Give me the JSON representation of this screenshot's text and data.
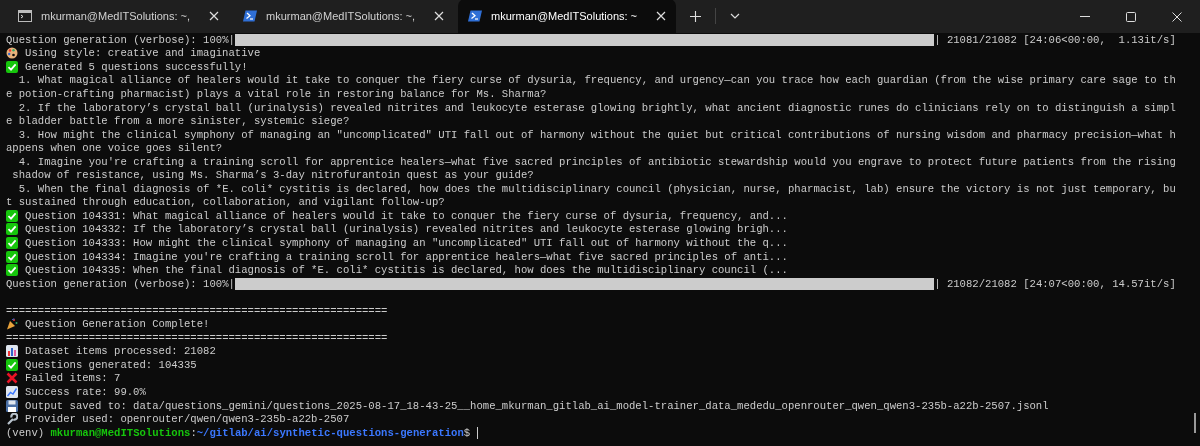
{
  "tabs": [
    {
      "title": "mkurman@MedITSolutions: ~,",
      "selected": false
    },
    {
      "title": "mkurman@MedITSolutions: ~,",
      "selected": false
    },
    {
      "title": "mkurman@MedITSolutions: ~",
      "selected": true
    }
  ],
  "lines": [
    {
      "kind": "progress",
      "prefix": "Question generation (verbose): 100%|",
      "level": 1,
      "suffix": "| 21081/21082 [24:06<00:00,  1.13it/s]"
    },
    {
      "kind": "palette",
      "text": "Using style: creative and imaginative"
    },
    {
      "kind": "check",
      "text": "Generated 5 questions successfully!"
    },
    {
      "kind": "text",
      "text": "  1. What magical alliance of healers would it take to conquer the fiery curse of dysuria, frequency, and urgency—can you trace how each guardian (from the wise primary care sage to th"
    },
    {
      "kind": "text",
      "text": "e potion-crafting pharmacist) plays a vital role in restoring balance for Ms. Sharma?"
    },
    {
      "kind": "text",
      "text": "  2. If the laboratory’s crystal ball (urinalysis) revealed nitrites and leukocyte esterase glowing brightly, what ancient diagnostic runes do clinicians rely on to distinguish a simpl"
    },
    {
      "kind": "text",
      "text": "e bladder battle from a more sinister, systemic siege?"
    },
    {
      "kind": "text",
      "text": "  3. How might the clinical symphony of managing an \"uncomplicated\" UTI fall out of harmony without the quiet but critical contributions of nursing wisdom and pharmacy precision—what h"
    },
    {
      "kind": "text",
      "text": "appens when one voice goes silent?"
    },
    {
      "kind": "text",
      "text": "  4. Imagine you're crafting a training scroll for apprentice healers—what five sacred principles of antibiotic stewardship would you engrave to protect future patients from the rising"
    },
    {
      "kind": "text",
      "text": " shadow of resistance, using Ms. Sharma’s 3-day nitrofurantoin quest as your guide?"
    },
    {
      "kind": "text",
      "text": "  5. When the final diagnosis of *E. coli* cystitis is declared, how does the multidisciplinary council (physician, nurse, pharmacist, lab) ensure the victory is not just temporary, bu"
    },
    {
      "kind": "text",
      "text": "t sustained through education, collaboration, and vigilant follow-up?"
    },
    {
      "kind": "check",
      "text": "Question 104331: What magical alliance of healers would it take to conquer the fiery curse of dysuria, frequency, and..."
    },
    {
      "kind": "check",
      "text": "Question 104332: If the laboratory’s crystal ball (urinalysis) revealed nitrites and leukocyte esterase glowing brigh..."
    },
    {
      "kind": "check",
      "text": "Question 104333: How might the clinical symphony of managing an \"uncomplicated\" UTI fall out of harmony without the q..."
    },
    {
      "kind": "check",
      "text": "Question 104334: Imagine you're crafting a training scroll for apprentice healers—what five sacred principles of anti..."
    },
    {
      "kind": "check",
      "text": "Question 104335: When the final diagnosis of *E. coli* cystitis is declared, how does the multidisciplinary council (..."
    },
    {
      "kind": "progress",
      "prefix": "Question generation (verbose): 100%|",
      "level": 1,
      "suffix": "| 21082/21082 [24:07<00:00, 14.57it/s]"
    },
    {
      "kind": "blank"
    },
    {
      "kind": "text",
      "text": "============================================================"
    },
    {
      "kind": "party",
      "text": "Question Generation Complete!"
    },
    {
      "kind": "text",
      "text": "============================================================"
    },
    {
      "kind": "chart",
      "text": "Dataset items processed: 21082"
    },
    {
      "kind": "check",
      "text": "Questions generated: 104335"
    },
    {
      "kind": "cross",
      "text": "Failed items: 7"
    },
    {
      "kind": "trend",
      "text": "Success rate: 99.0%"
    },
    {
      "kind": "disk",
      "text": "Output saved to: data/questions_gemini/questions_2025-08-17_18-43-25__home_mkurman_gitlab_ai_model-trainer_data_mededu_openrouter_qwen_qwen3-235b-a22b-2507.jsonl"
    },
    {
      "kind": "wrench",
      "text": "Provider used: openrouter/qwen/qwen3-235b-a22b-2507"
    },
    {
      "kind": "prompt",
      "segments": [
        {
          "text": "(venv) "
        },
        {
          "text": "mkurman@MedITSolutions",
          "color": "#16c60c"
        },
        {
          "text": ":"
        },
        {
          "text": "~/gitlab/ai/synthetic-questions-generation",
          "color": "#3b78ff"
        },
        {
          "text": "$ "
        }
      ]
    }
  ]
}
